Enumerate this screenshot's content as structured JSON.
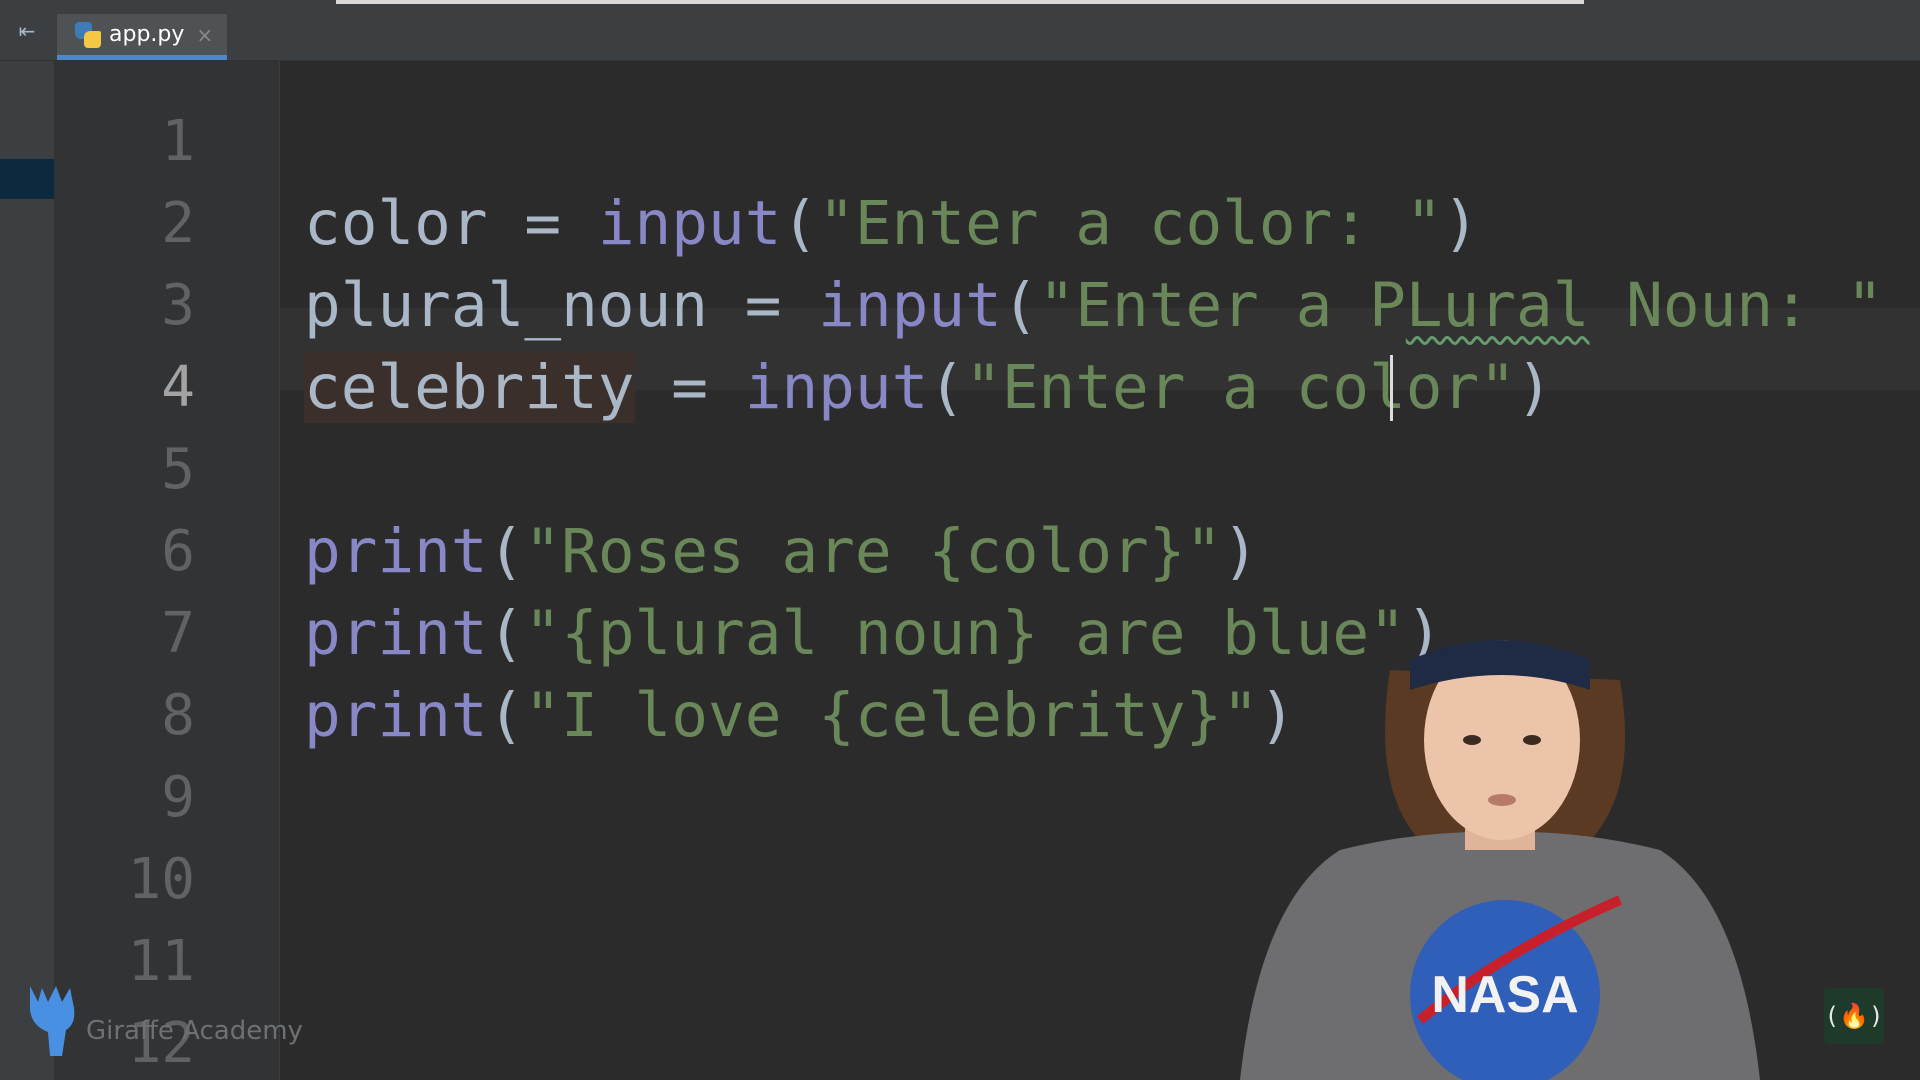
{
  "tab": {
    "filename": "app.py",
    "close": "×",
    "collapse": "⇤"
  },
  "gutter": {
    "line_numbers": [
      "1",
      "2",
      "3",
      "4",
      "5",
      "6",
      "7",
      "8",
      "9",
      "10",
      "11",
      "12"
    ]
  },
  "editor": {
    "lines": [
      [],
      [
        {
          "t": "color",
          "k": "ident"
        },
        {
          "t": " = ",
          "k": "op"
        },
        {
          "t": "input",
          "k": "builtin"
        },
        {
          "t": "(",
          "k": "paren"
        },
        {
          "t": "\"Enter a color: \"",
          "k": "str"
        },
        {
          "t": ")",
          "k": "paren"
        }
      ],
      [
        {
          "t": "plural_noun",
          "k": "ident"
        },
        {
          "t": " = ",
          "k": "op"
        },
        {
          "t": "input",
          "k": "builtin"
        },
        {
          "t": "(",
          "k": "paren"
        },
        {
          "t": "\"Enter a P",
          "k": "str"
        },
        {
          "t": "Lural",
          "k": "str typo"
        },
        {
          "t": " Noun: \"",
          "k": "str"
        }
      ],
      [
        {
          "t": "celebrity",
          "k": "ident hl"
        },
        {
          "t": " = ",
          "k": "op"
        },
        {
          "t": "input",
          "k": "builtin"
        },
        {
          "t": "(",
          "k": "paren"
        },
        {
          "t": "\"Enter a color\"",
          "k": "str"
        },
        {
          "t": ")",
          "k": "paren"
        }
      ],
      [],
      [
        {
          "t": "print",
          "k": "builtin"
        },
        {
          "t": "(",
          "k": "paren"
        },
        {
          "t": "\"Roses are {color}\"",
          "k": "str"
        },
        {
          "t": ")",
          "k": "paren"
        }
      ],
      [
        {
          "t": "print",
          "k": "builtin"
        },
        {
          "t": "(",
          "k": "paren"
        },
        {
          "t": "\"{plural noun} are blue\"",
          "k": "str"
        },
        {
          "t": ")",
          "k": "paren"
        }
      ],
      [
        {
          "t": "print",
          "k": "builtin"
        },
        {
          "t": "(",
          "k": "paren"
        },
        {
          "t": "\"I love {celebrity}\"",
          "k": "str"
        },
        {
          "t": ")",
          "k": "paren"
        }
      ],
      [],
      [],
      [],
      []
    ],
    "current_line": 4
  },
  "watermark": {
    "text": "Giraffe Academy"
  },
  "presenter": {
    "shirt_text": "NASA"
  },
  "badge": {
    "text": "(🔥)"
  },
  "colors": {
    "background": "#2b2b2b",
    "gutter": "#313335",
    "keyword_builtin": "#8888c6",
    "string": "#6a8759",
    "identifier": "#a9b7c6",
    "tab_underline": "#4a88c7"
  }
}
